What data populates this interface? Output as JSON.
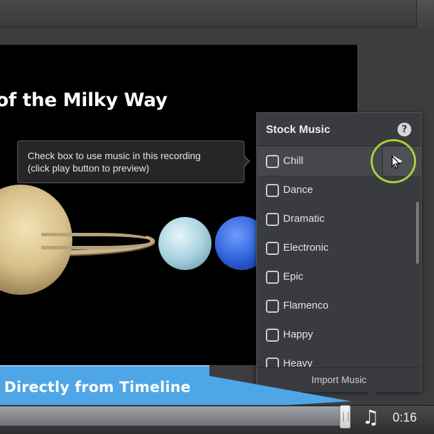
{
  "slide": {
    "title": "of the Milky Way"
  },
  "tooltip": {
    "line1": "Check box to use music in this recording",
    "line2": "(click play button to preview)"
  },
  "panel": {
    "title": "Stock Music",
    "help_icon": "?",
    "items": [
      {
        "label": "Chill",
        "checked": false
      },
      {
        "label": "Dance",
        "checked": false
      },
      {
        "label": "Dramatic",
        "checked": false
      },
      {
        "label": "Electronic",
        "checked": false
      },
      {
        "label": "Epic",
        "checked": false
      },
      {
        "label": "Flamenco",
        "checked": false
      },
      {
        "label": "Happy",
        "checked": false
      },
      {
        "label": "Heavy",
        "checked": false
      }
    ],
    "import_label": "Import Music"
  },
  "callout": {
    "text": "Directly from Timeline"
  },
  "timeline": {
    "music_icon": "♫",
    "time": "0:16"
  },
  "colors": {
    "highlight_ring": "#a7d23c",
    "callout": "#4fa6e6"
  }
}
